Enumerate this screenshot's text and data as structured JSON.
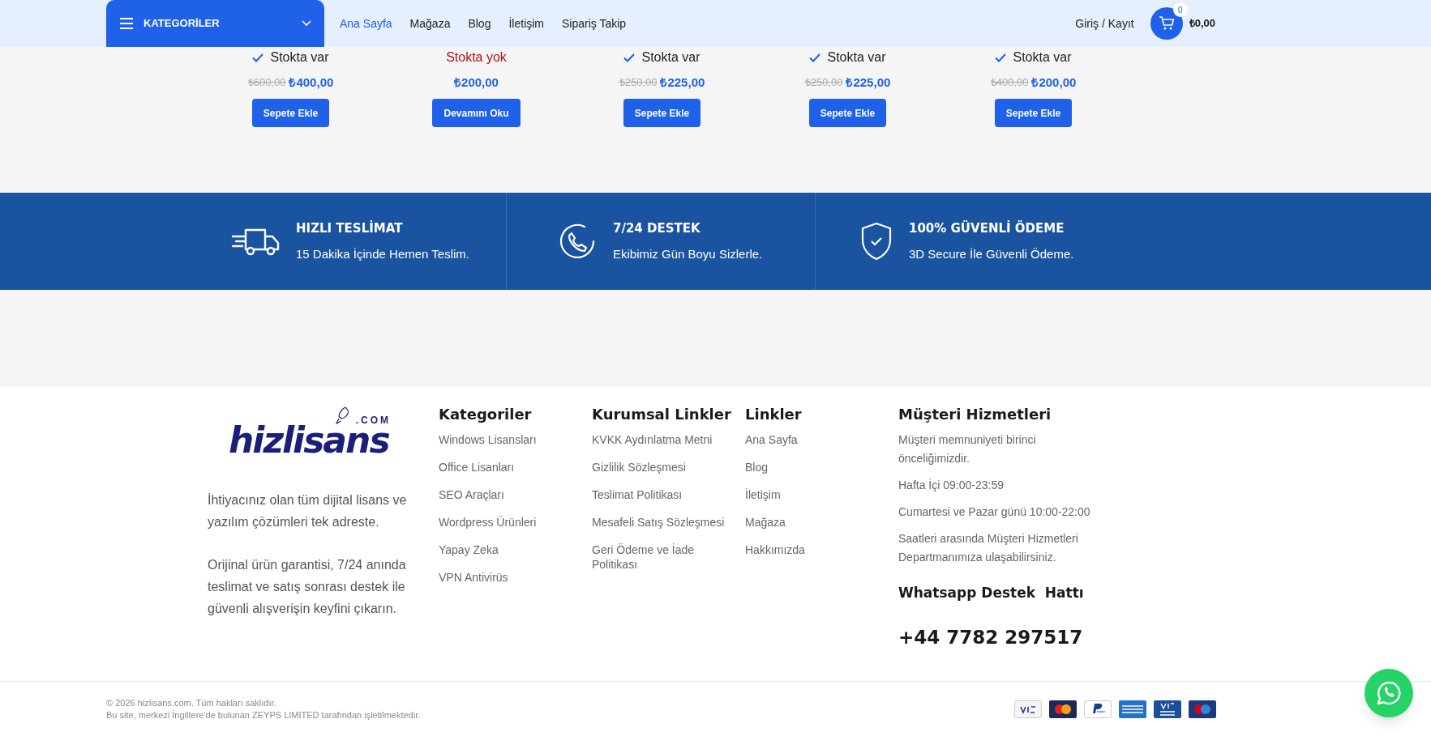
{
  "header": {
    "categories_button": "KATEGORİLER",
    "nav": [
      {
        "label": "Ana Sayfa",
        "selected": true
      },
      {
        "label": "Mağaza",
        "selected": false
      },
      {
        "label": "Blog",
        "selected": false
      },
      {
        "label": "İletişim",
        "selected": false
      },
      {
        "label": "Sipariş Takip",
        "selected": false
      }
    ],
    "login": "Giriş / Kayıt",
    "cart": {
      "count": "0",
      "total": "₺0,00"
    }
  },
  "products": [
    {
      "stock": {
        "in_stock": true,
        "label": "Stokta var"
      },
      "old_price": "₺600,00",
      "price": "₺400,00",
      "button": "Sepete Ekle"
    },
    {
      "stock": {
        "in_stock": false,
        "label": "Stokta yok"
      },
      "price": "₺200,00",
      "button": "Devamını Oku"
    },
    {
      "stock": {
        "in_stock": true,
        "label": "Stokta var"
      },
      "old_price": "₺250,00",
      "price": "₺225,00",
      "button": "Sepete Ekle"
    },
    {
      "stock": {
        "in_stock": true,
        "label": "Stokta var"
      },
      "old_price": "₺250,00",
      "price": "₺225,00",
      "button": "Sepete Ekle"
    },
    {
      "stock": {
        "in_stock": true,
        "label": "Stokta var"
      },
      "old_price": "₺400,00",
      "price": "₺200,00",
      "button": "Sepete Ekle"
    }
  ],
  "features": [
    {
      "kind": "truck",
      "title": "HIZLI TESLİMAT",
      "subtitle": "15 Dakika İçinde Hemen Teslim."
    },
    {
      "kind": "phone",
      "title": "7/24 DESTEK",
      "subtitle": "Ekibimiz Gün Boyu Sizlerle."
    },
    {
      "kind": "shield",
      "title": "100% GÜVENLİ ÖDEME",
      "subtitle": "3D Secure İle Güvenli Ödeme."
    }
  ],
  "footer": {
    "logo": {
      "name": "hizlisans",
      "suffix": ".COM"
    },
    "about": [
      "İhtiyacınız olan tüm dijital lisans ve yazılım çözümleri tek adreste.",
      "Orijinal ürün garantisi, 7/24 anında teslimat ve satış sonrası destek ile güvenli alışverişin keyfini çıkarın."
    ],
    "columns": [
      {
        "title": "Kategoriler",
        "links": [
          "Windows Lisansları",
          "Office Lisanları",
          "SEO Araçları",
          "Wordpress Ürünleri",
          "Yapay Zeka",
          "VPN Antivirüs"
        ]
      },
      {
        "title": "Kurumsal Linkler",
        "links": [
          "KVKK Aydınlatma Metni",
          "Gizlilik Sözleşmesi",
          "Teslimat Politikası",
          "Mesafeli Satış Sözleşmesi",
          "Geri Ödeme ve İade Politikası"
        ]
      },
      {
        "title": "Linkler",
        "links": [
          "Ana Sayfa",
          "Blog",
          "İletişim",
          "Mağaza",
          "Hakkımızda"
        ]
      }
    ],
    "service": {
      "title": "Müşteri Hizmetleri",
      "lines": [
        "Müşteri memnuniyeti birinci önceliğimizdir.",
        "Hafta İçi 09:00-23:59",
        "Cumartesi ve Pazar günü 10:00-22:00",
        "Saatleri arasında Müşteri Hizmetleri Departmanımıza ulaşabilirsiniz."
      ],
      "whatsapp_title": "Whatsapp Destek  Hattı",
      "phone": "+44 7782 297517"
    }
  },
  "bottom": {
    "copyright": [
      "© 2026 hizlisans.com. Tüm hakları saklıdır.",
      "Bu site, merkezi İngiltere'de bulunan ZEYPS LIMITED tarafından işletilmektedir."
    ],
    "payment_methods": [
      {
        "kind": "visa"
      },
      {
        "kind": "mastercard"
      },
      {
        "kind": "paypal"
      },
      {
        "kind": "amex"
      },
      {
        "kind": "visa-electron"
      },
      {
        "kind": "maestro"
      }
    ]
  }
}
